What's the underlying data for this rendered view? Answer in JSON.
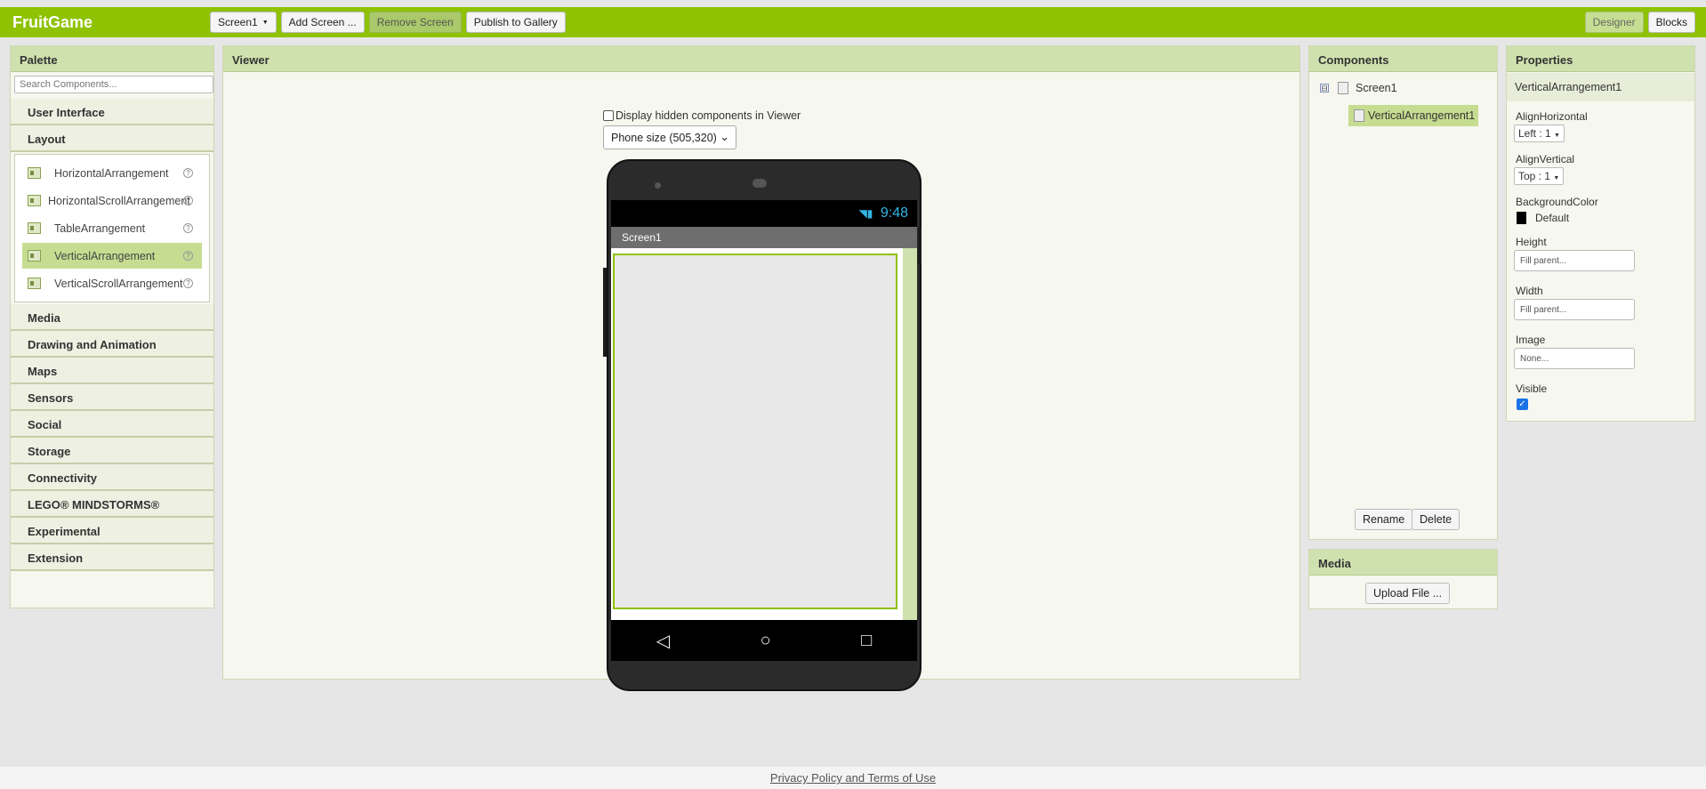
{
  "topbar": {
    "app_title": "FruitGame",
    "screen_select": "Screen1",
    "add_screen": "Add Screen ...",
    "remove_screen": "Remove Screen",
    "publish": "Publish to Gallery",
    "designer": "Designer",
    "blocks": "Blocks"
  },
  "palette": {
    "title": "Palette",
    "search_placeholder": "Search Components...",
    "categories_top": [
      "User Interface",
      "Layout"
    ],
    "layout_items": [
      {
        "label": "HorizontalArrangement"
      },
      {
        "label": "HorizontalScrollArrangement"
      },
      {
        "label": "TableArrangement"
      },
      {
        "label": "VerticalArrangement"
      },
      {
        "label": "VerticalScrollArrangement"
      }
    ],
    "help_glyph": "?",
    "categories_bottom": [
      "Media",
      "Drawing and Animation",
      "Maps",
      "Sensors",
      "Social",
      "Storage",
      "Connectivity",
      "LEGO® MINDSTORMS®",
      "Experimental",
      "Extension"
    ]
  },
  "viewer": {
    "title": "Viewer",
    "hidden_checkbox_label": "Display hidden components in Viewer",
    "phone_size": "Phone size (505,320)",
    "status_time": "9:48",
    "screen_title": "Screen1",
    "nav_back": "◁",
    "nav_home": "○",
    "nav_recent": "□"
  },
  "components": {
    "title": "Components",
    "collapse_glyph": "⊟",
    "root": "Screen1",
    "child": "VerticalArrangement1",
    "rename": "Rename",
    "delete": "Delete"
  },
  "media": {
    "title": "Media",
    "upload": "Upload File ..."
  },
  "properties": {
    "title": "Properties",
    "component": "VerticalArrangement1",
    "align_h_label": "AlignHorizontal",
    "align_h_value": "Left : 1",
    "align_v_label": "AlignVertical",
    "align_v_value": "Top : 1",
    "bg_label": "BackgroundColor",
    "bg_value": "Default",
    "height_label": "Height",
    "height_value": "Fill parent...",
    "width_label": "Width",
    "width_value": "Fill parent...",
    "image_label": "Image",
    "image_value": "None...",
    "visible_label": "Visible",
    "visible_checked": true
  },
  "footer": {
    "link": "Privacy Policy and Terms of Use"
  },
  "colors": {
    "brand": "#8fc202",
    "panel_head": "#cfe1ae",
    "selection": "#c6dd91"
  }
}
